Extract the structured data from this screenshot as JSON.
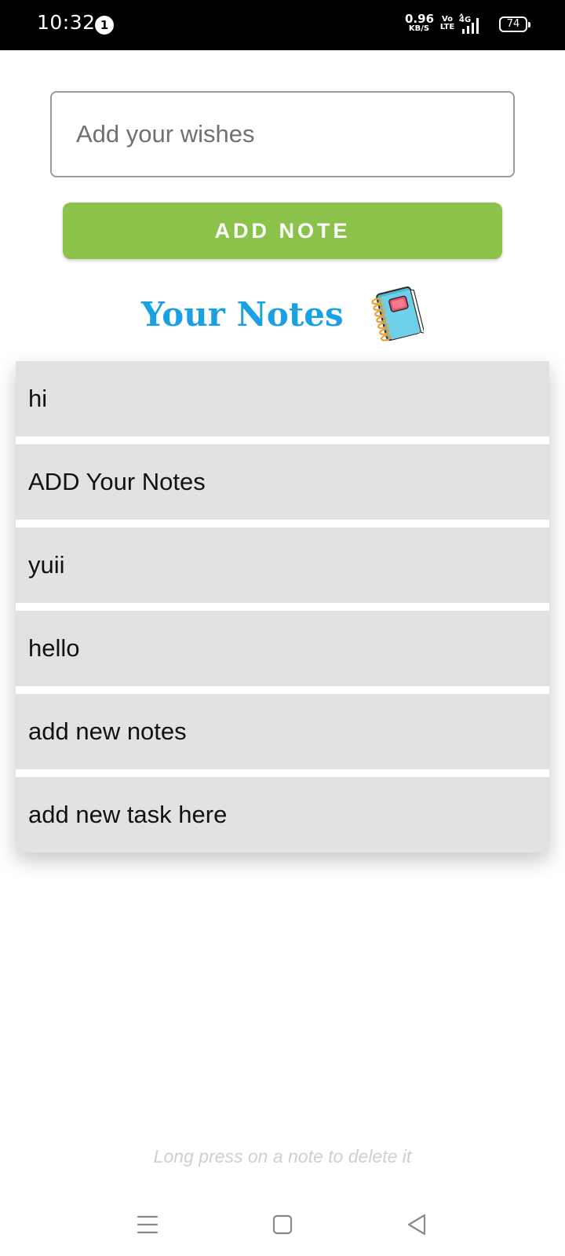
{
  "status_bar": {
    "time": "10:32",
    "notification_count": "1",
    "net_speed_value": "0.96",
    "net_speed_unit": "KB/S",
    "volte_top": "Vo",
    "volte_bottom": "LTE",
    "network_type": "4G",
    "battery_level": "74"
  },
  "form": {
    "input_placeholder": "Add your wishes",
    "add_button_label": "ADD NOTE",
    "button_color": "#8bc34a"
  },
  "heading": {
    "title": "Your Notes",
    "icon": "notebook-icon",
    "title_color": "#1ba1e2"
  },
  "notes": [
    {
      "text": "hi"
    },
    {
      "text": "ADD Your Notes"
    },
    {
      "text": "yuii"
    },
    {
      "text": "hello"
    },
    {
      "text": "add new notes"
    },
    {
      "text": "add new task here"
    }
  ],
  "hint": "Long press on a note to delete it",
  "nav_bar": {
    "buttons": [
      "menu-icon",
      "home-icon",
      "back-icon"
    ]
  }
}
